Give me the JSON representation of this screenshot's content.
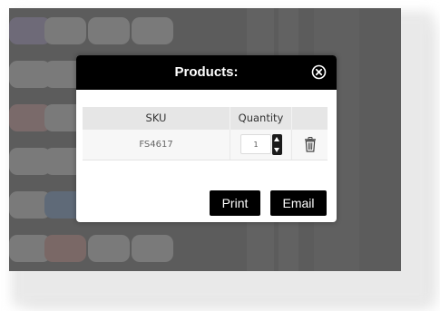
{
  "modal": {
    "title": "Products:",
    "close_icon": "close-circle-icon"
  },
  "table": {
    "headers": {
      "sku": "SKU",
      "quantity": "Quantity",
      "actions": ""
    },
    "rows": [
      {
        "sku": "FS4617",
        "quantity": "1",
        "delete_icon": "trash-icon"
      }
    ]
  },
  "buttons": {
    "print": "Print",
    "email": "Email"
  },
  "colors": {
    "header_bg": "#000000",
    "overlay": "#5c5c5c",
    "button_bg": "#000000",
    "button_text": "#ffffff"
  }
}
